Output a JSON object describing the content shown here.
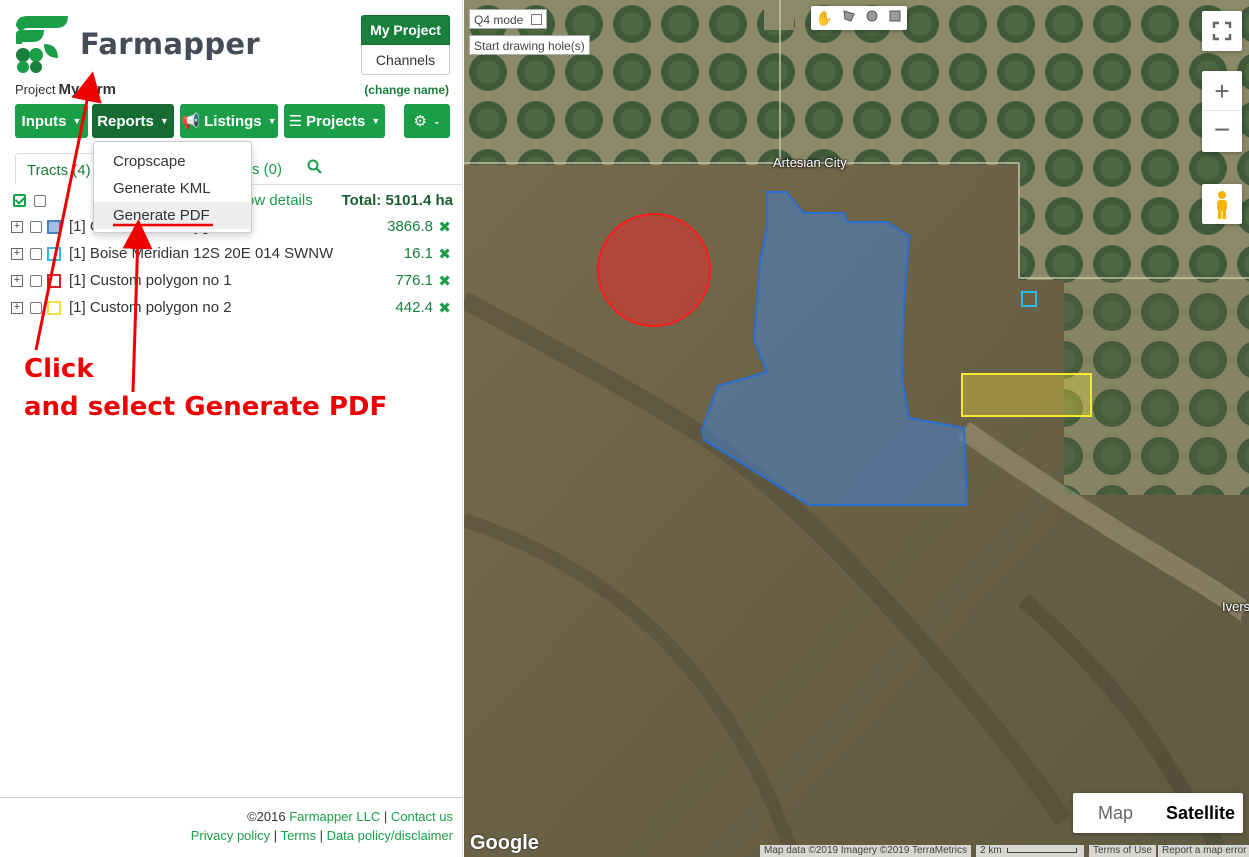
{
  "app": {
    "brand": "Farmapper",
    "my_project_label": "My Project",
    "channels_label": "Channels"
  },
  "project": {
    "prefix": "Project",
    "name": "My farm",
    "change_name": "(change name)"
  },
  "nav": {
    "inputs": "Inputs",
    "reports": "Reports",
    "listings": "Listings",
    "projects": "Projects"
  },
  "reports_menu": {
    "items": [
      "Cropscape",
      "Generate KML",
      "Generate PDF"
    ]
  },
  "tabs": {
    "tracts": "Tracts (4)",
    "other_count": "s  (0)"
  },
  "tracts": {
    "show_details": "ow details",
    "total": "Total: 5101.4 ha",
    "rows": [
      {
        "name": "[1] C",
        "name_tail": "ygon",
        "area": "3866.8",
        "color": "#4a7fc1"
      },
      {
        "name": "[1] Boise Meridian 12S 20E 014 SWNW",
        "area": "16.1",
        "color": "#33b5e5"
      },
      {
        "name": "[1] Custom polygon no 1",
        "area": "776.1",
        "color": "#e02020"
      },
      {
        "name": "[1] Custom polygon no 2",
        "area": "442.4",
        "color": "#f0e040"
      }
    ]
  },
  "annotations": {
    "line1": "Click",
    "line2": "and select Generate PDF"
  },
  "footer": {
    "copyright": "©2016 ",
    "company": "Farmapper LLC",
    "sep1": " | ",
    "contact": "Contact us",
    "privacy": "Privacy policy",
    "sep2": " | ",
    "terms": "Terms",
    "sep3": " | ",
    "data_policy": "Data policy/disclaimer"
  },
  "map": {
    "q4_mode": "Q4 mode",
    "start_drawing": "Start drawing hole(s)",
    "city_label": "Artesian City",
    "edge_label": "Ivers",
    "map_type_map": "Map",
    "map_type_satellite": "Satellite",
    "google": "Google",
    "attribution": "Map data ©2019 Imagery ©2019 TerraMetrics",
    "scale": "2 km",
    "terms": "Terms of Use",
    "report": "Report a map error",
    "colors": {
      "blue_polygon": "#4a7fc1",
      "red_circle": "#e03030",
      "yellow_rect": "#f0e040",
      "cyan_square": "#33b5e5"
    }
  }
}
